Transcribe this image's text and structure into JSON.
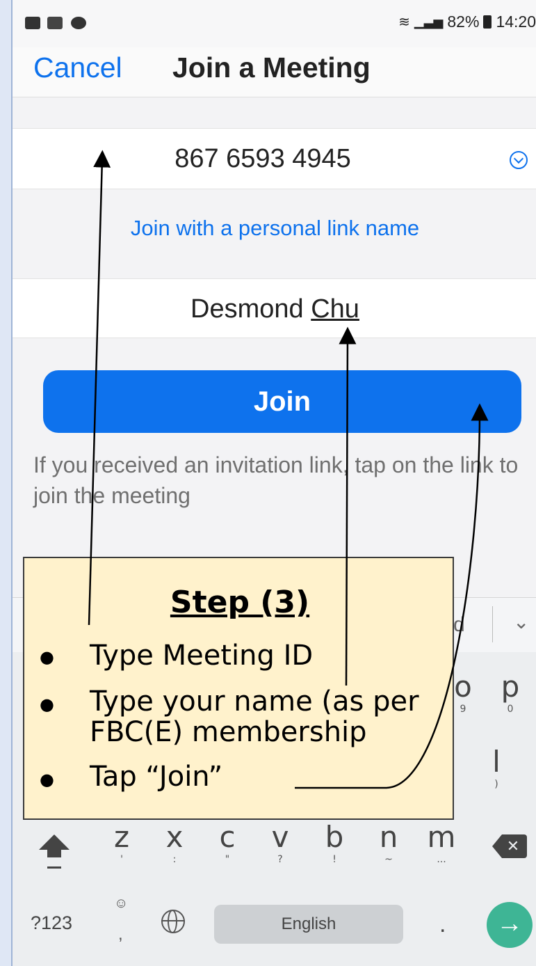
{
  "status_bar": {
    "battery": "82%",
    "time": "14:20",
    "left_icons": [
      "image-icon",
      "laz-icon",
      "chat-icon"
    ],
    "right_icons": [
      "wifi-icon",
      "signal-icon",
      "battery-icon"
    ]
  },
  "nav": {
    "cancel_label": "Cancel",
    "title": "Join a Meeting"
  },
  "form": {
    "meeting_id": "867 6593 4945",
    "personal_link_label": "Join with a personal link name",
    "name_first": "Desmond",
    "name_last": "Chu",
    "join_label": "Join",
    "hint": "If you received an invitation link, tap on the link to join the meeting"
  },
  "keyboard": {
    "suggestion_partial": "d",
    "row_keys_partial": [
      {
        "key": "o",
        "sub": "9"
      },
      {
        "key": "p",
        "sub": "0"
      }
    ],
    "row_l": {
      "key": "l",
      "sub": ")"
    },
    "row_bottom_letters": [
      {
        "key": "z",
        "sub": "'"
      },
      {
        "key": "x",
        "sub": ":"
      },
      {
        "key": "c",
        "sub": "\""
      },
      {
        "key": "v",
        "sub": "?"
      },
      {
        "key": "b",
        "sub": "!"
      },
      {
        "key": "n",
        "sub": "~"
      },
      {
        "key": "m",
        "sub": "..."
      }
    ],
    "symbols_label": "?123",
    "comma": ",",
    "space_label": "English",
    "period": ".",
    "enter_symbol": "→"
  },
  "callout": {
    "title": "Step (3)",
    "items": [
      "Type Meeting ID",
      "Type your name (as per FBC(E) membership",
      "Tap “Join”"
    ]
  },
  "colors": {
    "accent": "#0e72ed",
    "callout_bg": "#fff2cc",
    "enter_key": "#3eb595"
  }
}
